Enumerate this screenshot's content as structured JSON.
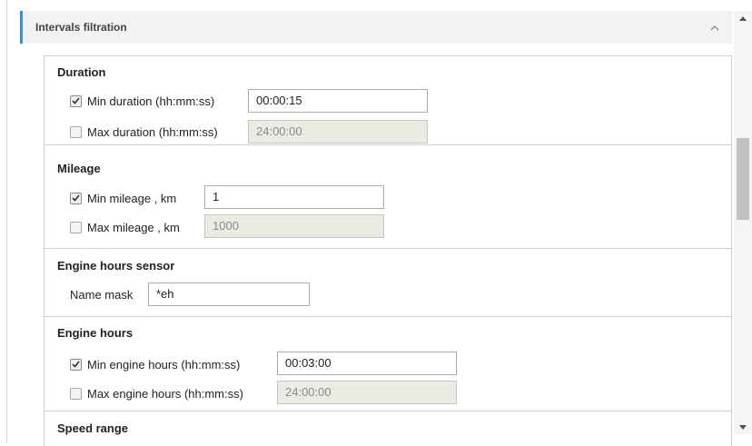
{
  "panel": {
    "title": "Intervals filtration"
  },
  "duration": {
    "title": "Duration",
    "min": {
      "label": "Min duration (hh:mm:ss)",
      "checked": true,
      "value": "00:00:15"
    },
    "max": {
      "label": "Max duration (hh:mm:ss)",
      "checked": false,
      "value": "24:00:00"
    }
  },
  "mileage": {
    "title": "Mileage",
    "min": {
      "label": "Min mileage , km",
      "checked": true,
      "value": "1"
    },
    "max": {
      "label": "Max mileage , km",
      "checked": false,
      "value": "1000"
    }
  },
  "engine_sensor": {
    "title": "Engine hours sensor",
    "name_mask": {
      "label": "Name mask",
      "value": "*eh"
    }
  },
  "engine_hours": {
    "title": "Engine hours",
    "min": {
      "label": "Min engine hours (hh:mm:ss)",
      "checked": true,
      "value": "00:03:00"
    },
    "max": {
      "label": "Max engine hours (hh:mm:ss)",
      "checked": false,
      "value": "24:00:00"
    }
  },
  "speed_range": {
    "title": "Speed range"
  },
  "icons": {
    "collapse": "chevron-up-icon",
    "check": "checkmark-icon",
    "scroll_up": "scroll-up-arrow-icon",
    "scroll_down": "scroll-down-arrow-icon"
  },
  "colors": {
    "accent": "#3b8fd6",
    "disabled_bg": "#ebebe4"
  }
}
